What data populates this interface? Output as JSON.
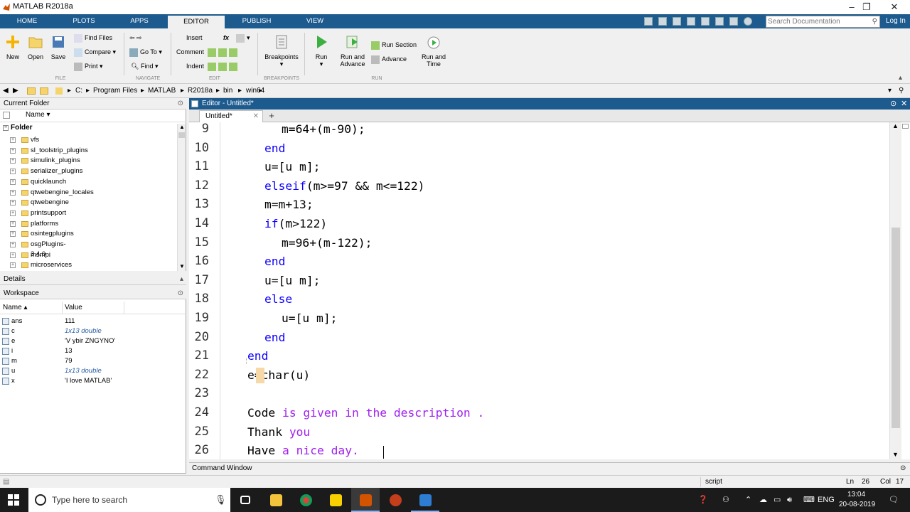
{
  "window": {
    "title": "MATLAB R2018a",
    "minimize": "–",
    "restore": "❐",
    "close": "✕"
  },
  "tabs": [
    "HOME",
    "PLOTS",
    "APPS",
    "EDITOR",
    "PUBLISH",
    "VIEW"
  ],
  "active_tab": "EDITOR",
  "search": {
    "placeholder": "Search Documentation",
    "icon": "search-icon"
  },
  "login": "Log In",
  "toolstrip": {
    "file": {
      "new": "New",
      "open": "Open",
      "save": "Save",
      "find_files": "Find Files",
      "compare": "Compare",
      "print": "Print",
      "label": "FILE"
    },
    "navigate": {
      "goto": "Go To",
      "find": "Find",
      "label": "NAVIGATE"
    },
    "edit": {
      "insert": "Insert",
      "comment": "Comment",
      "indent": "Indent",
      "fx": "fx",
      "label": "EDIT"
    },
    "breakpoints": {
      "btn": "Breakpoints",
      "label": "BREAKPOINTS"
    },
    "run": {
      "run": "Run",
      "run_advance_1": "Run and",
      "run_advance_2": "Advance",
      "run_section": "Run Section",
      "advance": "Advance",
      "run_time_1": "Run and",
      "run_time_2": "Time",
      "label": "RUN"
    }
  },
  "path": [
    "C:",
    "Program Files",
    "MATLAB",
    "R2018a",
    "bin",
    "win64"
  ],
  "current_folder": {
    "title": "Current Folder",
    "col_name": "Name ▾",
    "folder_label": "Folder",
    "items": [
      "vfs",
      "sl_toolstrip_plugins",
      "simulink_plugins",
      "serializer_plugins",
      "quicklaunch",
      "qtwebengine_locales",
      "qtwebengine",
      "printsupport",
      "platforms",
      "osintegplugins",
      "osgPlugins-3.4.0",
      "msmpi",
      "microservices"
    ]
  },
  "details": {
    "title": "Details"
  },
  "workspace": {
    "title": "Workspace",
    "col_name": "Name ▴",
    "col_value": "Value",
    "vars": [
      {
        "name": "ans",
        "value": "111",
        "italic": false
      },
      {
        "name": "c",
        "value": "1x13 double",
        "italic": true
      },
      {
        "name": "e",
        "value": "'V ybir ZNGYNO'",
        "italic": false
      },
      {
        "name": "i",
        "value": "13",
        "italic": false
      },
      {
        "name": "m",
        "value": "79",
        "italic": false
      },
      {
        "name": "u",
        "value": "1x13 double",
        "italic": true
      },
      {
        "name": "x",
        "value": "'I love MATLAB'",
        "italic": false
      }
    ]
  },
  "editor": {
    "title": "Editor - Untitled*",
    "tab": "Untitled*",
    "tab_close": "✕",
    "add_tab": "+",
    "lines": [
      {
        "n": "9",
        "indent": 8,
        "parts": [
          {
            "t": "m=64+(m-90);",
            "c": "n"
          }
        ]
      },
      {
        "n": "10",
        "indent": 4,
        "parts": [
          {
            "t": "end",
            "c": "k"
          }
        ]
      },
      {
        "n": "11",
        "indent": 4,
        "parts": [
          {
            "t": "u=[u m];",
            "c": "n"
          }
        ]
      },
      {
        "n": "12",
        "indent": 4,
        "parts": [
          {
            "t": "elseif",
            "c": "k"
          },
          {
            "t": "(m>=97 && m<=122)",
            "c": "n"
          }
        ]
      },
      {
        "n": "13",
        "indent": 4,
        "parts": [
          {
            "t": "m=m+13;",
            "c": "n"
          }
        ]
      },
      {
        "n": "14",
        "indent": 4,
        "parts": [
          {
            "t": "if",
            "c": "k"
          },
          {
            "t": "(m>122)",
            "c": "n"
          }
        ]
      },
      {
        "n": "15",
        "indent": 8,
        "parts": [
          {
            "t": "m=96+(m-122);",
            "c": "n"
          }
        ]
      },
      {
        "n": "16",
        "indent": 4,
        "parts": [
          {
            "t": "end",
            "c": "k"
          }
        ]
      },
      {
        "n": "17",
        "indent": 4,
        "parts": [
          {
            "t": "u=[u m];",
            "c": "n"
          }
        ]
      },
      {
        "n": "18",
        "indent": 4,
        "parts": [
          {
            "t": "else",
            "c": "k"
          }
        ]
      },
      {
        "n": "19",
        "indent": 8,
        "parts": [
          {
            "t": "u=[u m];",
            "c": "n"
          }
        ]
      },
      {
        "n": "20",
        "indent": 4,
        "parts": [
          {
            "t": "end",
            "c": "k"
          }
        ]
      },
      {
        "n": "21",
        "indent": 0,
        "parts": [
          {
            "t": "end",
            "c": "k"
          }
        ]
      },
      {
        "n": "22",
        "indent": 0,
        "parts": [
          {
            "t": "e=char(u)",
            "c": "n"
          }
        ]
      },
      {
        "n": "23",
        "indent": 0,
        "parts": [
          {
            "t": "",
            "c": "n"
          }
        ]
      },
      {
        "n": "24",
        "indent": 0,
        "parts": [
          {
            "t": "Code ",
            "c": "n"
          },
          {
            "t": "is given in the description .",
            "c": "c"
          }
        ]
      },
      {
        "n": "25",
        "indent": 0,
        "parts": [
          {
            "t": "Thank ",
            "c": "n"
          },
          {
            "t": "you",
            "c": "c"
          }
        ]
      },
      {
        "n": "26",
        "indent": 0,
        "parts": [
          {
            "t": "Have ",
            "c": "n"
          },
          {
            "t": "a nice day.",
            "c": "c"
          }
        ]
      }
    ]
  },
  "command_window": {
    "title": "Command Window"
  },
  "status": {
    "mode": "script",
    "ln_label": "Ln",
    "ln": "26",
    "col_label": "Col",
    "col": "17"
  },
  "taskbar": {
    "search": "Type here to search",
    "lang": "ENG",
    "time": "13:04",
    "date": "20-08-2019"
  },
  "colors": {
    "accent": "#1d5a8e",
    "keyword": "#0e00ff",
    "string": "#a020f0"
  }
}
